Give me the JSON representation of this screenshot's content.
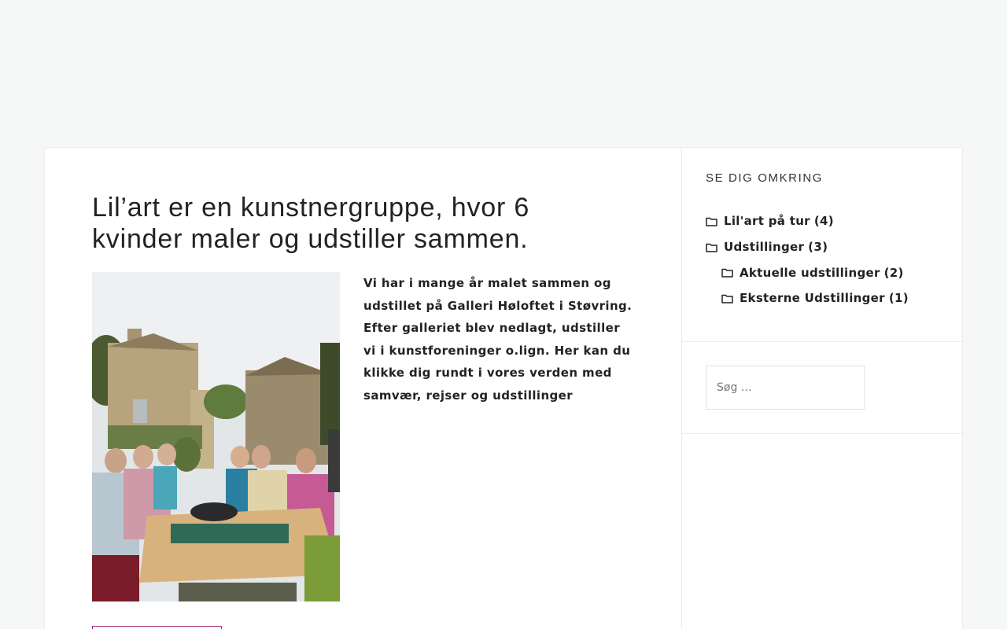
{
  "post": {
    "title": "Lil’art er en kunstnergruppe, hvor 6 kvinder maler og udstiller sammen.",
    "body": "Vi har i mange år malet sammen og udstillet på Galleri Høloftet i Støvring. Efter galleriet blev nedlagt, udstiller vi i kunstforeninger o.lign. Her kan du klikke dig rundt i vores verden med samvær, rejser og udstillinger"
  },
  "sidebar": {
    "categories_title": "SE DIG OMKRING",
    "categories": [
      {
        "label": "Lil'art på tur",
        "count": "(4)",
        "level": 0
      },
      {
        "label": "Udstillinger",
        "count": "(3)",
        "level": 0
      },
      {
        "label": "Aktuelle udstillinger",
        "count": "(2)",
        "level": 1
      },
      {
        "label": "Eksterne Udstillinger",
        "count": "(1)",
        "level": 1
      }
    ],
    "search_placeholder": "Søg …"
  },
  "colors": {
    "page_bg": "#f5f8f7",
    "accent": "#a0287a"
  }
}
